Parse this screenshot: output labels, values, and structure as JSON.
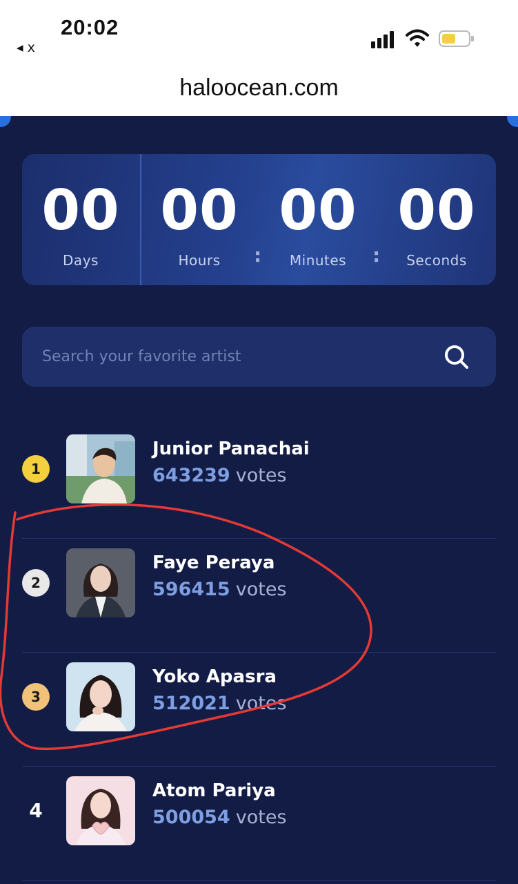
{
  "status_bar": {
    "back_label": "◂ x",
    "time": "20:02",
    "battery_color": "#f4d03f"
  },
  "browser": {
    "url": "haloocean.com"
  },
  "countdown": {
    "units": [
      {
        "value": "00",
        "label": "Days"
      },
      {
        "value": "00",
        "label": "Hours"
      },
      {
        "value": "00",
        "label": "Minutes"
      },
      {
        "value": "00",
        "label": "Seconds"
      }
    ],
    "separator": ":"
  },
  "search": {
    "placeholder": "Search your favorite artist",
    "icon": "search-icon"
  },
  "ranking": [
    {
      "rank": "1",
      "name": "Junior Panachai",
      "votes": "643239",
      "unit": "votes",
      "badge": "gold"
    },
    {
      "rank": "2",
      "name": "Faye Peraya",
      "votes": "596415",
      "unit": "votes",
      "badge": "silver"
    },
    {
      "rank": "3",
      "name": "Yoko Apasra",
      "votes": "512021",
      "unit": "votes",
      "badge": "bronze"
    },
    {
      "rank": "4",
      "name": "Atom Pariya",
      "votes": "500054",
      "unit": "votes",
      "badge": "none"
    }
  ],
  "colors": {
    "page_bg": "#121c45",
    "accent": "#2a6fe0",
    "vote_count": "#7e9ee2",
    "gold": "#f4d03f",
    "silver": "#e8e8e8",
    "bronze": "#f2c27a",
    "annotation": "#e53935"
  }
}
